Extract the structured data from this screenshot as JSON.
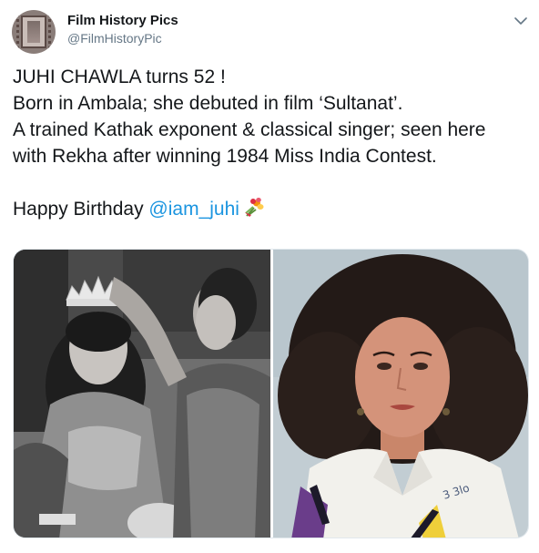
{
  "author": {
    "display_name": "Film History Pics",
    "handle": "@FilmHistoryPic",
    "avatar_icon": "film-strip-avatar"
  },
  "menu": {
    "icon": "chevron-down-icon"
  },
  "tweet": {
    "line1": "JUHI CHAWLA turns 52 !",
    "line2": "Born in Ambala; she debuted in film ‘Sultanat’.",
    "line3": "A trained Kathak exponent & classical singer; seen here",
    "line4": "with Rekha after winning 1984 Miss India Contest.",
    "greeting": "Happy Birthday ",
    "mention": "@iam_juhi",
    "emoji": "bouquet-icon"
  },
  "media": {
    "count": 2,
    "photo_left": "black-and-white photo of crowning at Miss India 1984",
    "photo_right": "color portrait photo",
    "right_photo_annotation": "3 3lo"
  },
  "colors": {
    "text": "#14171a",
    "secondary": "#657786",
    "link": "#1b95e0",
    "border": "#e1e8ed"
  }
}
